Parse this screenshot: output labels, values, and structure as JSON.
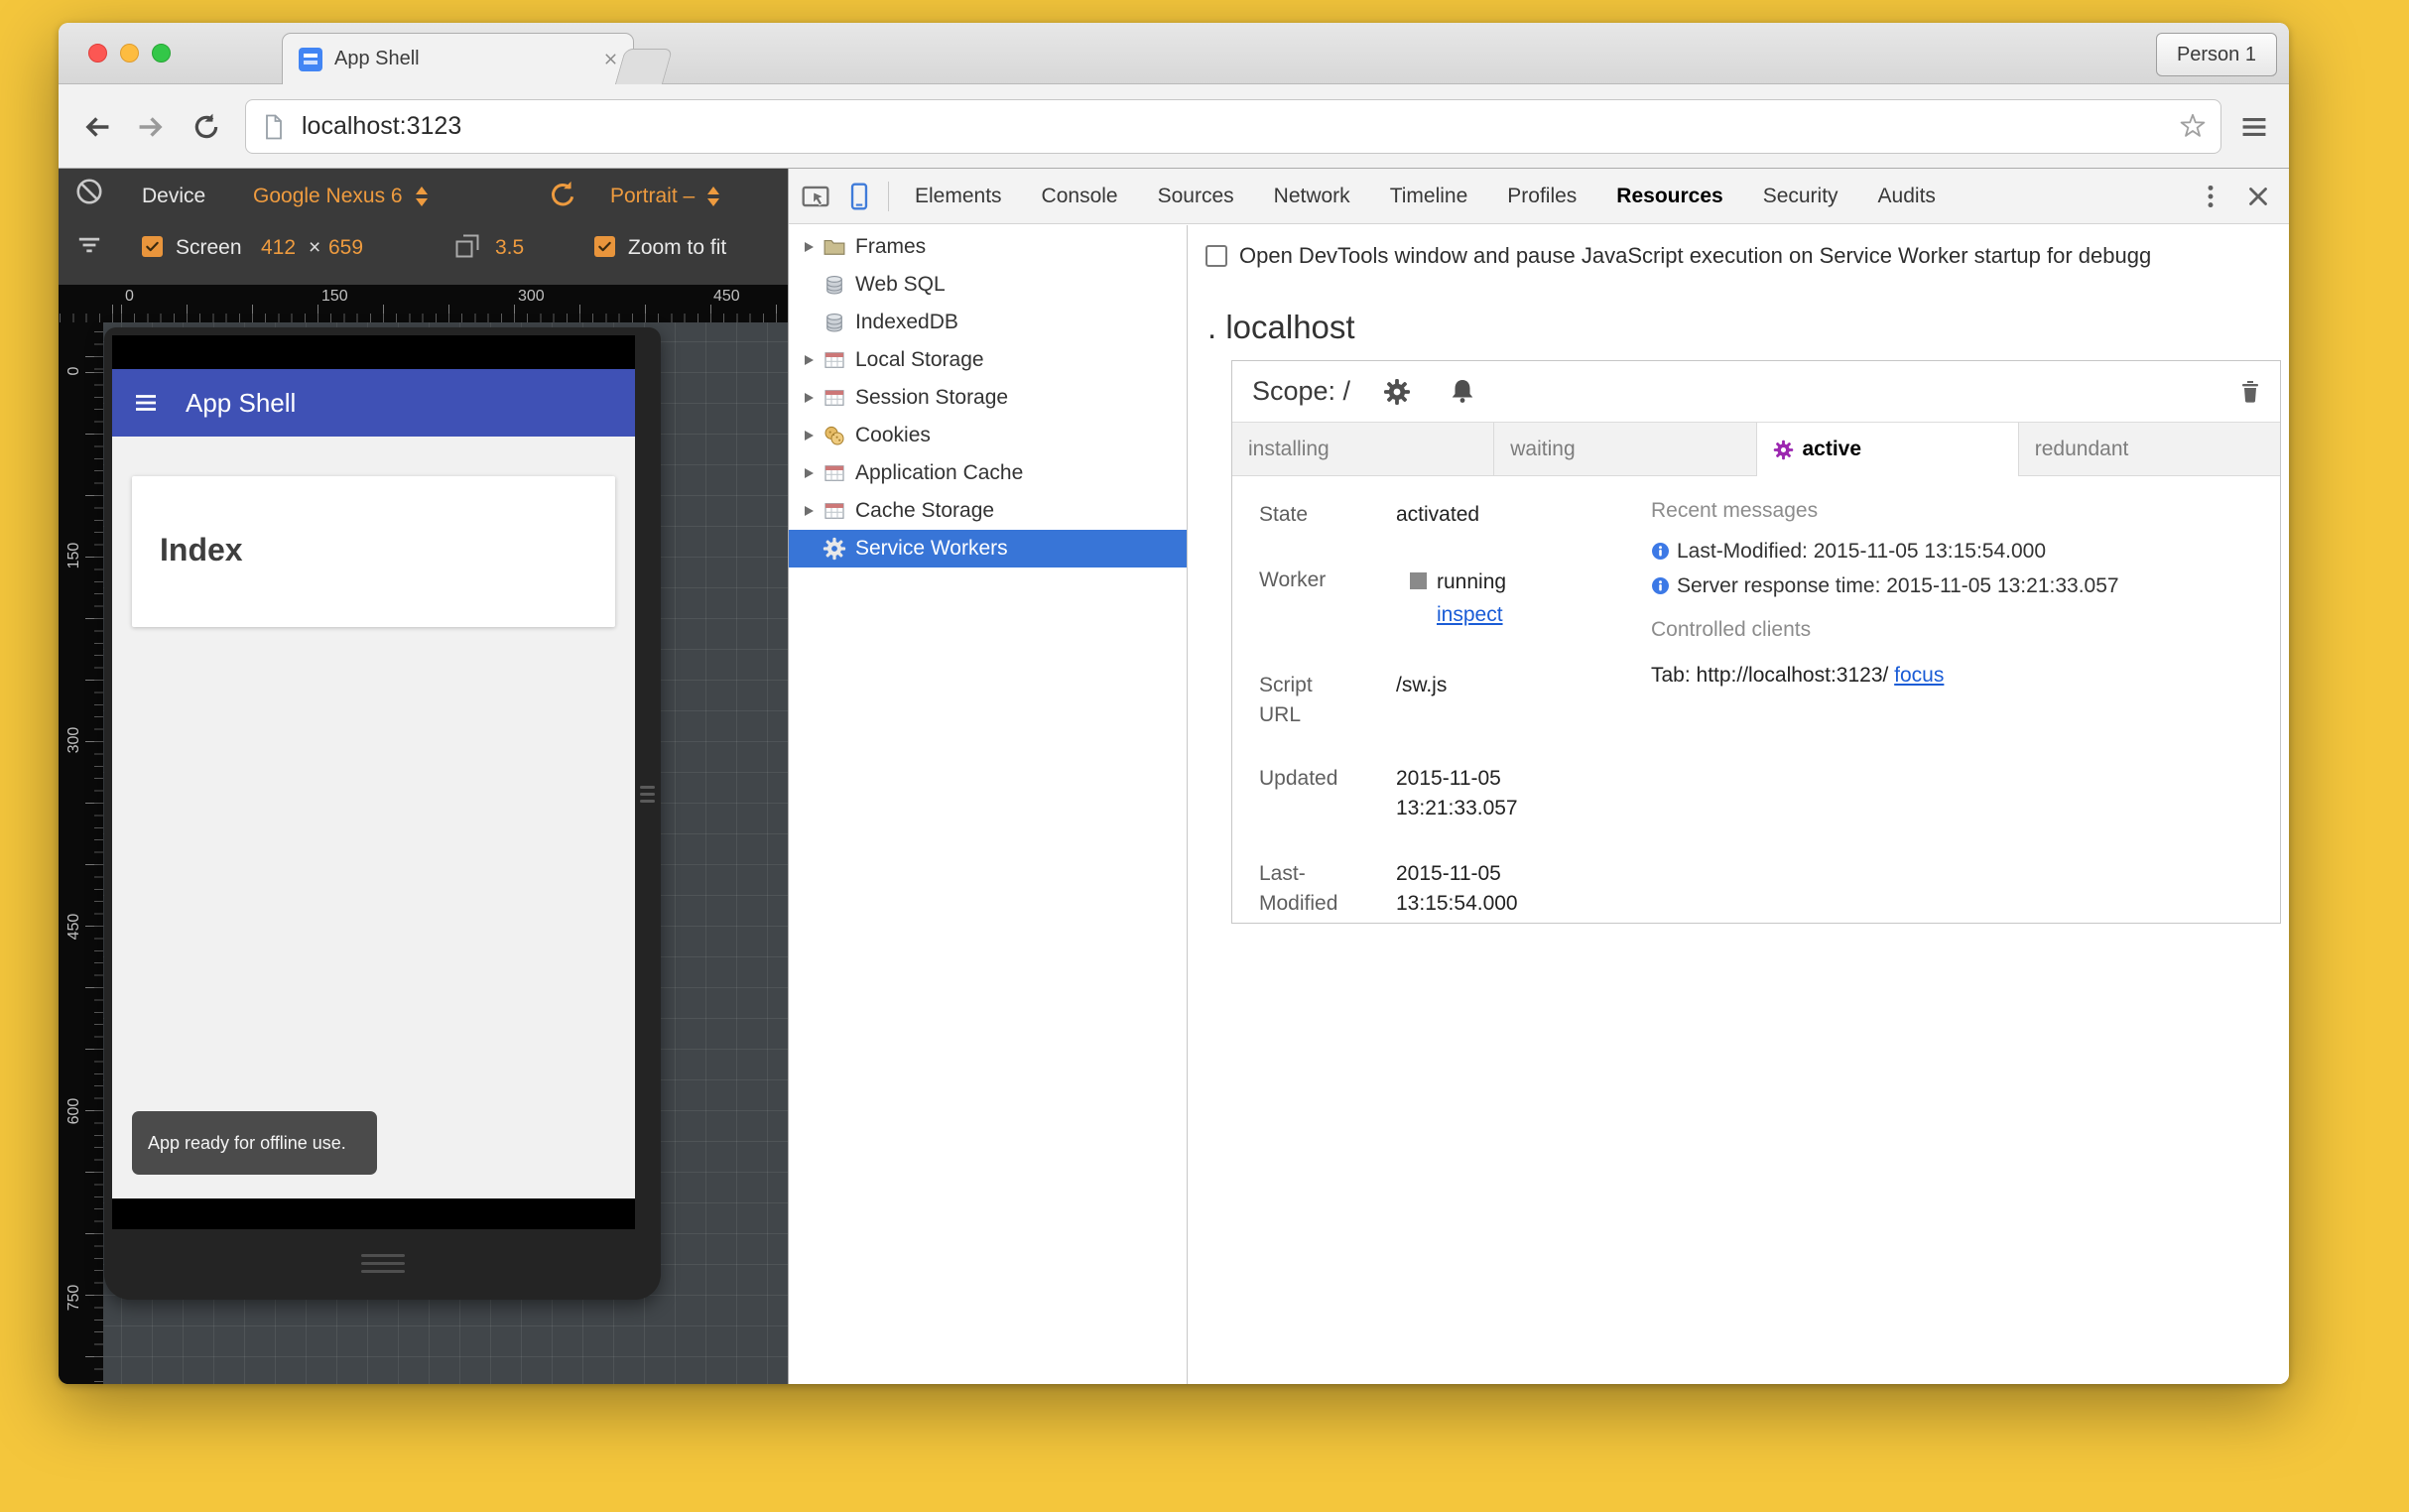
{
  "colors": {
    "background_yellow": "#F4C63C",
    "app_header_indigo": "#3F51B5",
    "selection_blue": "#3875D7",
    "devtools_toolbar_orange": "#EE9B3F",
    "active_gear_purple": "#9C27B0",
    "link_blue": "#1A5CD6"
  },
  "icons": {
    "traffic_lights": "close / minimize / zoom circles",
    "tab_close": "x",
    "back": "left-arrow",
    "forward": "right-arrow",
    "reload": "circular-arrow",
    "bookmark": "star-outline",
    "browser_menu": "hamburger",
    "block": "circle-slash",
    "throttle": "stacked-bars",
    "rotate": "circular-arrow",
    "dpr": "overlapping-squares",
    "checkbox_checked": "amber-check",
    "inspect": "cursor-in-box",
    "device_mode": "phone",
    "overflow": "vertical-dots",
    "devtools_close": "x",
    "folder": "folder",
    "database": "cylinder",
    "table": "grid-table",
    "cookie": "cookies",
    "service_worker": "gear",
    "push": "bell",
    "delete": "trash",
    "info": "blue-info-circle",
    "worker_stop": "gray-square"
  },
  "chrome": {
    "tab_title": "App Shell",
    "profile_button": "Person 1",
    "url": "localhost:3123"
  },
  "device_toolbar": {
    "device_label": "Device",
    "device_model": "Google Nexus 6",
    "orientation": "Portrait –",
    "screen_label": "Screen",
    "width": "412",
    "times": "×",
    "height": "659",
    "dpr": "3.5",
    "zoom_label": "Zoom to fit"
  },
  "rulers": {
    "horizontal": [
      "0",
      "150",
      "300",
      "450"
    ],
    "vertical": [
      "0",
      "150",
      "300",
      "450",
      "600",
      "750"
    ]
  },
  "app": {
    "header_title": "App Shell",
    "heading": "Index",
    "toast": "App ready for offline use."
  },
  "devtools": {
    "tabs": [
      "Elements",
      "Console",
      "Sources",
      "Network",
      "Timeline",
      "Profiles",
      "Resources",
      "Security",
      "Audits"
    ],
    "selected_tab": "Resources",
    "sw_pause_label": "Open DevTools window and pause JavaScript execution on Service Worker startup for debugg",
    "sidebar": [
      "Frames",
      "Web SQL",
      "IndexedDB",
      "Local Storage",
      "Session Storage",
      "Cookies",
      "Application Cache",
      "Cache Storage",
      "Service Workers"
    ],
    "origin_title": ". localhost",
    "scope_label": "Scope: /",
    "version_tabs": [
      "installing",
      "waiting",
      "active",
      "redundant"
    ],
    "details": {
      "state_label": "State",
      "state_value": "activated",
      "worker_label": "Worker",
      "worker_status": "running",
      "inspect_link": "inspect",
      "script_url_label": "Script URL",
      "script_url_value": "/sw.js",
      "updated_label": "Updated",
      "updated_value": "2015-11-05 13:21:33.057",
      "last_modified_label": "Last-Modified",
      "last_modified_value": "2015-11-05 13:15:54.000"
    },
    "recent_messages_title": "Recent messages",
    "messages": [
      "Last-Modified: 2015-11-05 13:15:54.000",
      "Server response time: 2015-11-05 13:21:33.057"
    ],
    "controlled_clients_title": "Controlled clients",
    "client_text": "Tab: http://localhost:3123/",
    "focus_link": "focus"
  }
}
